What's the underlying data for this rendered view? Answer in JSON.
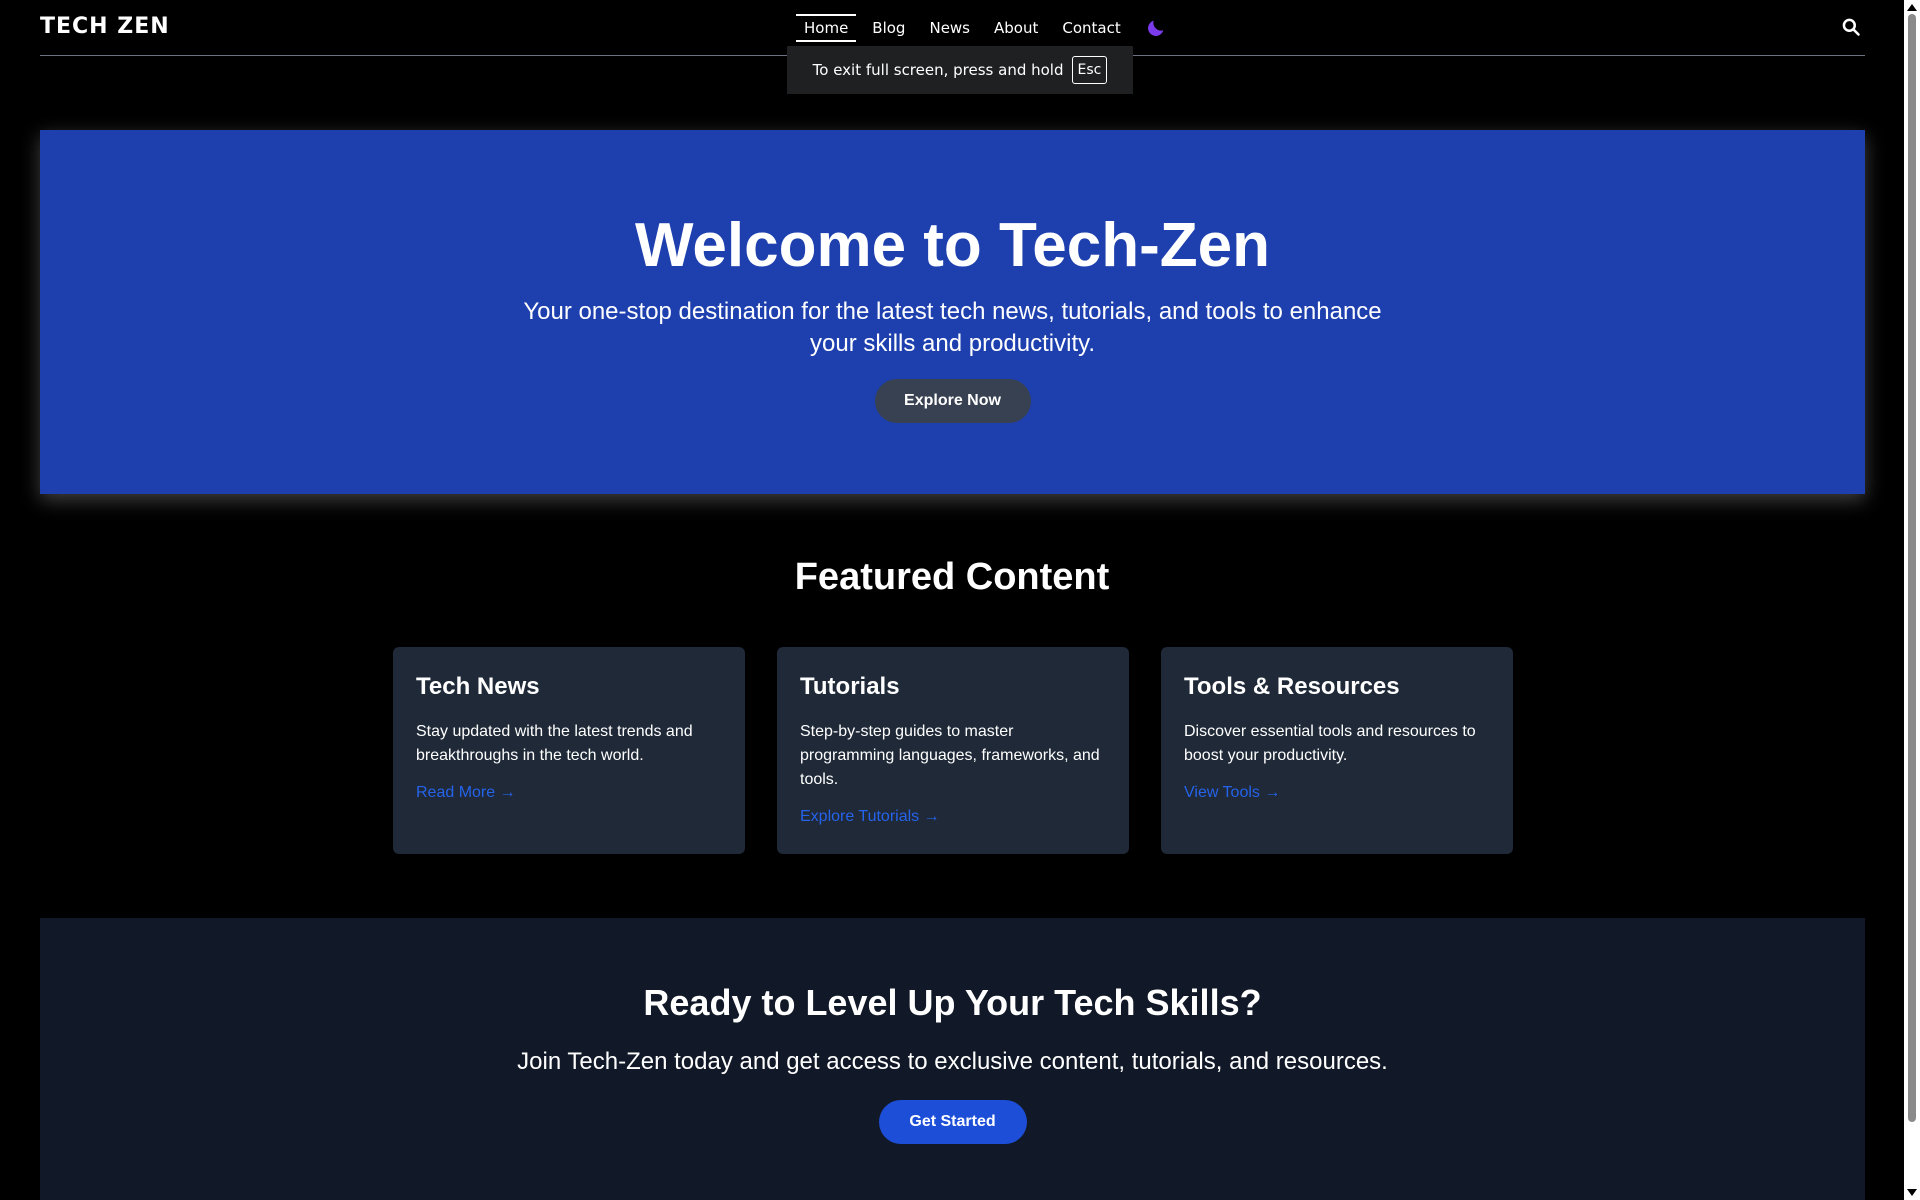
{
  "header": {
    "logo": "TECH ZEN",
    "nav": [
      "Home",
      "Blog",
      "News",
      "About",
      "Contact"
    ],
    "active_nav": "Home"
  },
  "fullscreen_toast": {
    "message": "To exit full screen, press and hold",
    "key": "Esc"
  },
  "hero": {
    "title": "Welcome to Tech-Zen",
    "subtitle": "Your one-stop destination for the latest tech news, tutorials, and tools to enhance your skills and productivity.",
    "button": "Explore Now"
  },
  "featured": {
    "title": "Featured Content",
    "cards": [
      {
        "title": "Tech News",
        "text": "Stay updated with the latest trends and breakthroughs in the tech world.",
        "link": "Read More →"
      },
      {
        "title": "Tutorials",
        "text": "Step-by-step guides to master programming languages, frameworks, and tools.",
        "link": "Explore Tutorials →"
      },
      {
        "title": "Tools & Resources",
        "text": "Discover essential tools and resources to boost your productivity.",
        "link": "View Tools →"
      }
    ]
  },
  "cta": {
    "title": "Ready to Level Up Your Tech Skills?",
    "subtitle": "Join Tech-Zen today and get access to exclusive content, tutorials, and resources.",
    "button": "Get Started"
  },
  "colors": {
    "background": "#000000",
    "hero_bg": "#1e40af",
    "card_bg": "#1f2937",
    "cta_bg": "#111827",
    "link": "#2563eb",
    "moon_icon": "#7c3aed"
  },
  "icons": [
    "moon-icon",
    "search-icon"
  ]
}
